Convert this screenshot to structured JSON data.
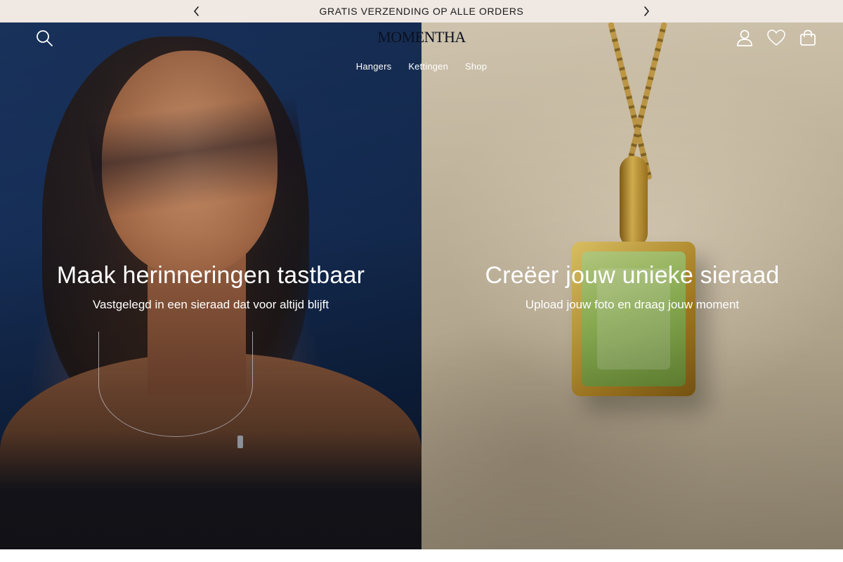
{
  "announcement": {
    "text": "GRATIS VERZENDING OP ALLE ORDERS",
    "prev_icon": "chevron-left-icon",
    "next_icon": "chevron-right-icon"
  },
  "header": {
    "logo": "MOMENTHA",
    "icons": [
      "search-icon",
      "user-icon",
      "heart-icon",
      "shopping-bag-icon"
    ],
    "nav": [
      {
        "label": "Hangers"
      },
      {
        "label": "Kettingen"
      },
      {
        "label": "Shop"
      }
    ]
  },
  "hero": {
    "panels": [
      {
        "title": "Maak herinneringen tastbaar",
        "subtitle": "Vastgelegd in een sieraad dat voor altijd blijft"
      },
      {
        "title": "Creëer jouw unieke sieraad",
        "subtitle": "Upload jouw foto en draag jouw moment"
      }
    ]
  },
  "colors": {
    "announcement_bg": "#efe8e3",
    "text_light": "#ffffff",
    "logo": "#0a1020"
  }
}
